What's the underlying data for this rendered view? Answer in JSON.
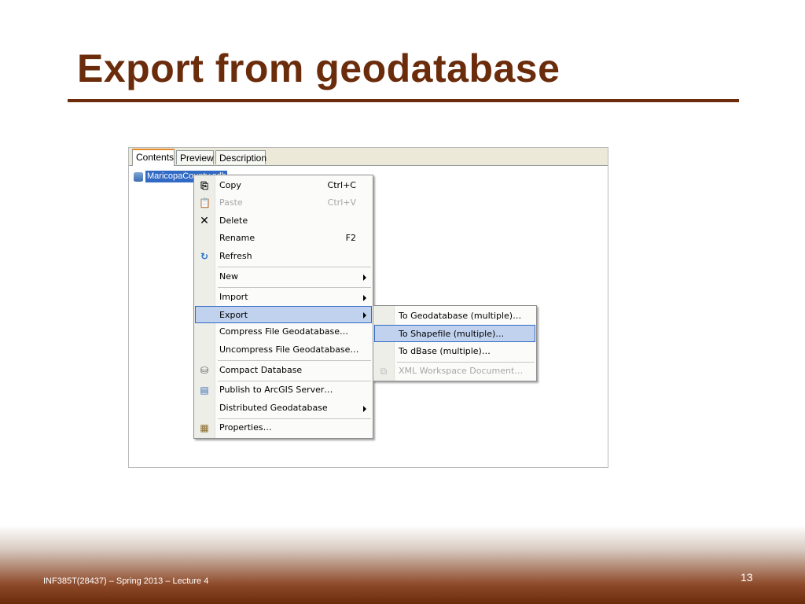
{
  "slide": {
    "title": "Export from geodatabase",
    "footer": "INF385T(28437) – Spring 2013 – Lecture 4",
    "page_number": "13"
  },
  "catalog": {
    "tabs": [
      {
        "label": "Contents",
        "active": true
      },
      {
        "label": "Preview",
        "active": false
      },
      {
        "label": "Description",
        "active": false
      }
    ],
    "tree_item": {
      "label": "MaricopaCounty.gdb",
      "icon": "database-icon"
    }
  },
  "context_menu": {
    "items": [
      {
        "label": "Copy",
        "shortcut": "Ctrl+C",
        "icon": "copy-icon",
        "enabled": true
      },
      {
        "label": "Paste",
        "shortcut": "Ctrl+V",
        "icon": "paste-icon",
        "enabled": false
      },
      {
        "label": "Delete",
        "shortcut": "",
        "icon": "delete-x-icon",
        "enabled": true
      },
      {
        "label": "Rename",
        "shortcut": "F2",
        "icon": "",
        "enabled": true
      },
      {
        "label": "Refresh",
        "shortcut": "",
        "icon": "refresh-icon",
        "enabled": true
      },
      {
        "label": "New",
        "submenu": true
      },
      {
        "label": "Import",
        "submenu": true
      },
      {
        "label": "Export",
        "submenu": true,
        "highlighted": true
      },
      {
        "label": "Compress File Geodatabase…"
      },
      {
        "label": "Uncompress File Geodatabase…"
      },
      {
        "label": "Compact Database",
        "icon": "compact-database-icon"
      },
      {
        "label": "Publish to ArcGIS Server…",
        "icon": "publish-server-icon"
      },
      {
        "label": "Distributed Geodatabase",
        "submenu": true
      },
      {
        "label": "Properties…",
        "icon": "properties-icon"
      }
    ]
  },
  "export_submenu": {
    "items": [
      {
        "label": "To Geodatabase (multiple)…",
        "enabled": true
      },
      {
        "label": "To Shapefile (multiple)…",
        "enabled": true,
        "highlighted": true
      },
      {
        "label": "To dBase (multiple)…",
        "enabled": true
      },
      {
        "label": "XML Workspace Document…",
        "enabled": false,
        "icon": "xml-workspace-icon"
      }
    ]
  },
  "colors": {
    "title": "#6b2c0c",
    "highlight_fill": "#c1d2ee",
    "highlight_border": "#316ac5"
  }
}
